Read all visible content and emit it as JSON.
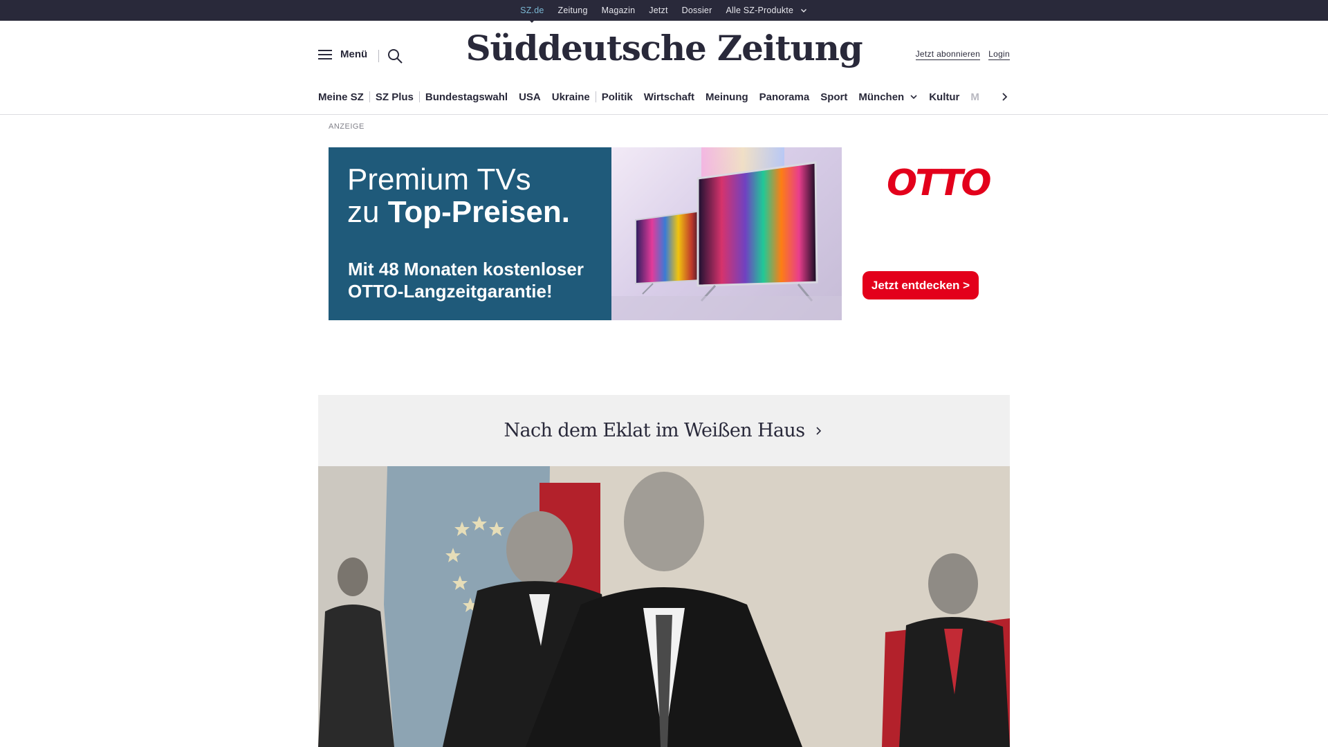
{
  "topbar": {
    "links": [
      "SZ.de",
      "Zeitung",
      "Magazin",
      "Jetzt",
      "Dossier",
      "Alle SZ-Produkte"
    ]
  },
  "header": {
    "menu_label": "Menü",
    "logo": "Süddeutsche Zeitung",
    "subscribe_label": "Jetzt abonnieren",
    "login_label": "Login"
  },
  "nav": {
    "items": [
      "Meine SZ",
      "SZ Plus",
      "Bundestagswahl",
      "USA",
      "Ukraine",
      "Politik",
      "Wirtschaft",
      "Meinung",
      "Panorama",
      "Sport",
      "München",
      "Kultur",
      "M"
    ]
  },
  "ad": {
    "label": "ANZEIGE",
    "headline_line1": "Premium TVs",
    "headline_line2_prefix": "zu ",
    "headline_line2_bold": "Top-Preisen.",
    "subline": "Mit 48 Monaten kostenloser OTTO-Langzeitgarantie!",
    "brand": "OTTO",
    "cta": "Jetzt entdecken >",
    "colors": {
      "panel": "#1f5a7a",
      "brand_red": "#e3001b"
    }
  },
  "topic": {
    "title": "Nach dem Eklat im Weißen Haus"
  },
  "icons": {
    "menu": "hamburger-icon",
    "search": "search-icon",
    "dropdown": "chevron-down-icon",
    "next": "chevron-right-icon"
  },
  "colors": {
    "top_bar": "#29293a",
    "active_link": "#7bb8d4",
    "topic_background": "#f0f0f0"
  }
}
